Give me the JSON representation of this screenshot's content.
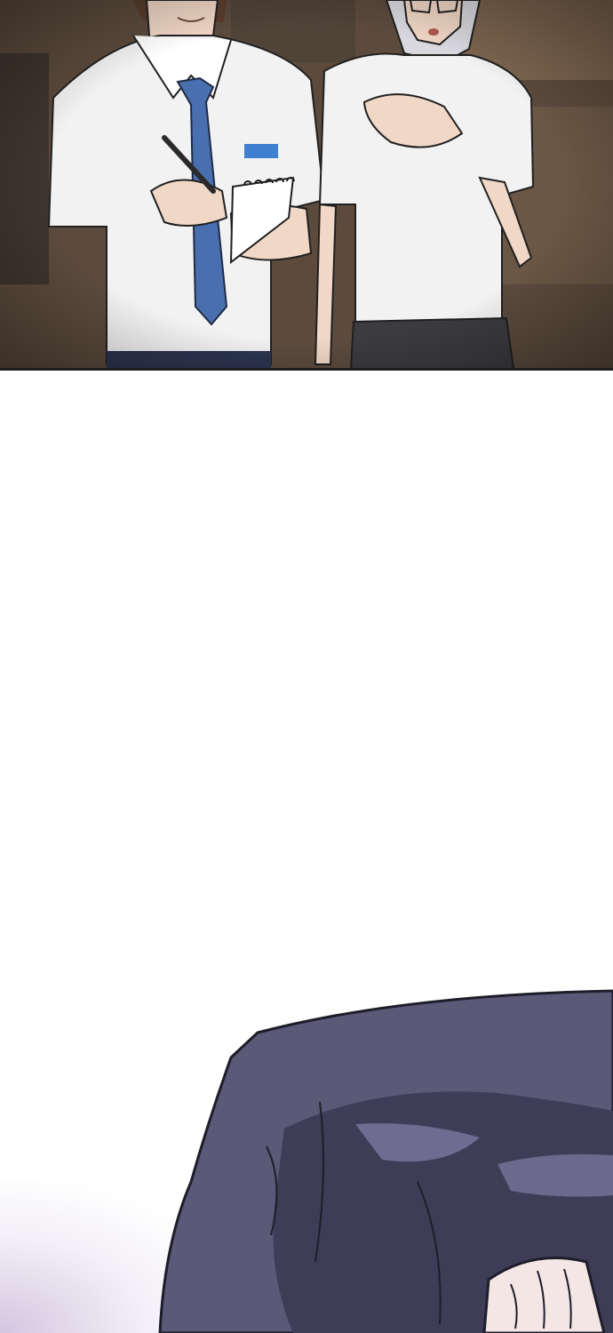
{
  "panels": [
    {
      "id": "top",
      "characters": [
        "boy-with-notepad",
        "girl-with-glasses"
      ],
      "colors": {
        "background": "#5c4b3d",
        "shirt": "#f2f2f2",
        "tie": "#4a6fae",
        "name_tag": "#3f7fd0",
        "skin": "#f1d7c6",
        "boy_hair": "#5a3d2b",
        "girl_hair": "#d9d9df",
        "skirt": "#3b3b40",
        "outline": "#202020"
      }
    },
    {
      "id": "bottom",
      "characters": [
        "dark-haired-character"
      ],
      "colors": {
        "hair": "#5b5878",
        "hair_shadow": "#3e3c56",
        "hair_light": "#77749a",
        "sparkle": "#cbbfdd"
      }
    }
  ]
}
